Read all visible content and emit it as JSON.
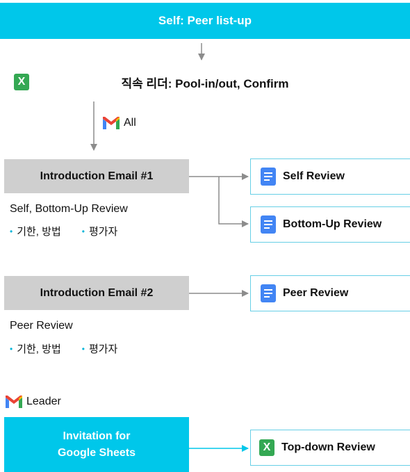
{
  "flow": {
    "step1": "Self: Peer list-up",
    "step2": {
      "label": "직속 리더: Pool-in/out, Confirm",
      "icon": "sheets-x-icon",
      "icon_glyph": "X"
    },
    "branch_all": {
      "icon": "gmail-icon",
      "label": "All"
    },
    "email1": {
      "label": "Introduction Email #1",
      "note": "Self, Bottom-Up Review",
      "bullets": [
        "기한, 방법",
        "평가자"
      ]
    },
    "email2": {
      "label": "Introduction Email #2",
      "note": "Peer Review",
      "bullets": [
        "기한, 방법",
        "평가자"
      ]
    },
    "branch_leader": {
      "icon": "gmail-icon",
      "label": "Leader"
    },
    "invitation": {
      "line1": "Invitation for",
      "line2": "Google Sheets"
    }
  },
  "outputs": {
    "self_review": {
      "label": "Self Review",
      "icon": "docs-icon"
    },
    "bottom_up_review": {
      "label": "Bottom-Up Review",
      "icon": "docs-icon"
    },
    "peer_review": {
      "label": "Peer Review",
      "icon": "docs-icon"
    },
    "top_down_review": {
      "label": "Top-down Review",
      "icon": "sheets-x-icon",
      "icon_glyph": "X"
    }
  },
  "colors": {
    "accent_cyan": "#00c7ea",
    "grey_box": "#cfcfcf",
    "arrow_grey": "#8c8c8c",
    "docs_blue": "#4285f4",
    "sheets_green": "#34a853"
  }
}
